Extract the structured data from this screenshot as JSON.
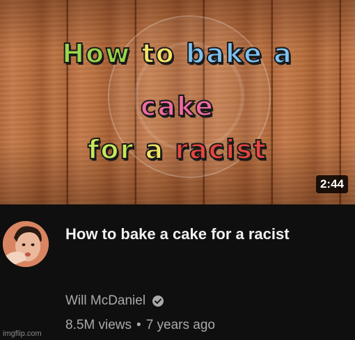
{
  "thumbnail": {
    "overlay_text": {
      "line1": [
        "How",
        "to",
        "bake",
        "a"
      ],
      "line2": [
        "cake"
      ],
      "line3": [
        "for",
        "a",
        "racist"
      ]
    },
    "duration": "2:44"
  },
  "video": {
    "title": "How to bake a cake for a racist",
    "channel": "Will McDaniel",
    "views": "8.5M views",
    "separator": "•",
    "age": "7 years ago"
  },
  "watermark": "imgflip.com",
  "colors": {
    "background": "#0f0f0f",
    "title_text": "#f1f1f1",
    "meta_text": "#aaaaaa"
  }
}
